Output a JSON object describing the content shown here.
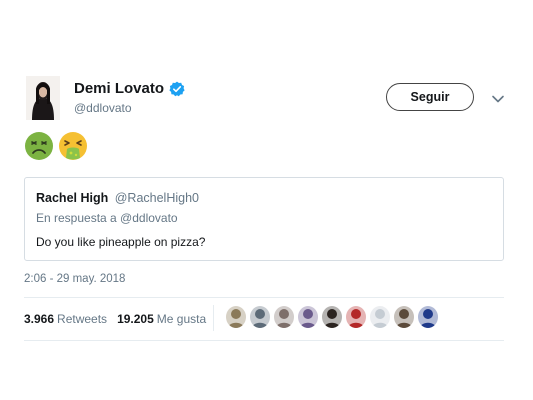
{
  "tweet": {
    "author_name": "Demi Lovato",
    "author_handle": "@ddlovato",
    "follow_label": "Seguir",
    "emojis": [
      "nauseated-face-icon",
      "vomiting-face-icon"
    ],
    "quoted": {
      "author_name": "Rachel High",
      "author_handle": "@RachelHigh0",
      "reply_to": "En respuesta a @ddlovato",
      "text": "Do you like pineapple on pizza?"
    },
    "timestamp": "2:06 - 29 may. 2018",
    "retweets_count": "3.966",
    "retweets_label": "Retweets",
    "likes_count": "19.205",
    "likes_label": "Me gusta",
    "likers": [
      {
        "icon": "liker-avatar-1",
        "color": "#8b7a5a"
      },
      {
        "icon": "liker-avatar-2",
        "color": "#5d6b78"
      },
      {
        "icon": "liker-avatar-3",
        "color": "#7e6f6a"
      },
      {
        "icon": "liker-avatar-4",
        "color": "#6a5a8c"
      },
      {
        "icon": "liker-avatar-5",
        "color": "#2b2420"
      },
      {
        "icon": "liker-avatar-6",
        "color": "#b42828"
      },
      {
        "icon": "liker-avatar-7",
        "color": "#c5ccd3"
      },
      {
        "icon": "liker-avatar-8",
        "color": "#5b4a3a"
      },
      {
        "icon": "liker-avatar-9",
        "color": "#1f3a8a"
      }
    ]
  },
  "colors": {
    "verified": "#1da1f2",
    "muted_text": "#657786",
    "border": "#d6dde3"
  }
}
